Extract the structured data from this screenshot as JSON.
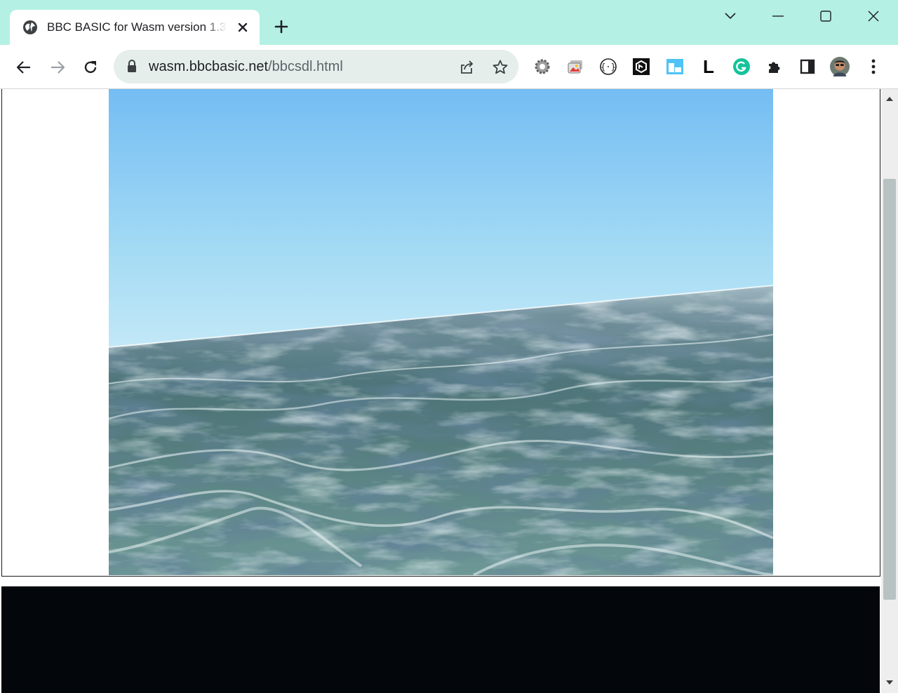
{
  "window": {
    "minimize_label": "Minimize",
    "maximize_label": "Maximize",
    "close_label": "Close"
  },
  "tab": {
    "title": "BBC BASIC for Wasm version 1.3",
    "active": true
  },
  "address_bar": {
    "host": "wasm.bbcbasic.net",
    "path": "/bbcsdl.html"
  },
  "toolbar": {
    "buttons": [
      "back-icon",
      "forward-icon",
      "reload-icon"
    ],
    "extensions": [
      "gear-extension-icon",
      "image-extension-icon",
      "code-braces-extension-icon",
      "hexagon-extension-icon",
      "window-extension-icon",
      "l-extension-icon",
      "grammarly-extension-icon",
      "puzzle-extensions-icon",
      "side-panel-icon",
      "profile-avatar",
      "menu-kebab-icon"
    ],
    "l_extension_letter": "L"
  },
  "colors": {
    "tabstrip": "#b4f0e4",
    "omnibox": "#e6eeec",
    "sky_top": "#74bdf3",
    "sky_horizon": "#f4fbfd",
    "sea_deep": "#4d7480",
    "console": "#03060a"
  }
}
